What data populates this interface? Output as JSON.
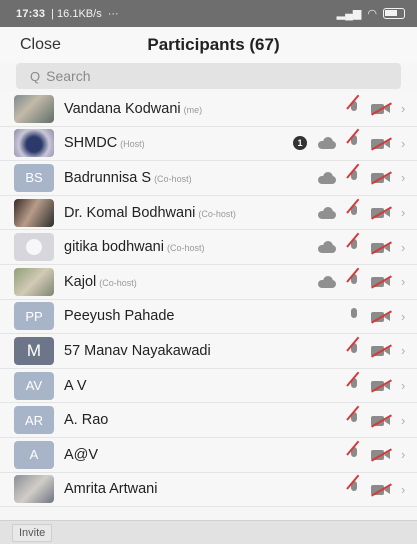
{
  "status_bar": {
    "time": "17:33",
    "speed": "| 16.1KB/s",
    "extra": "··· "
  },
  "header": {
    "close_label": "Close",
    "title": "Participants (67)"
  },
  "search": {
    "placeholder": "Search"
  },
  "participants": [
    {
      "name": "Vandana Kodwani",
      "role": "(me)",
      "avatar_type": "photo",
      "avatar_text": "",
      "unread": "",
      "recording": false,
      "mic_muted": true,
      "video_off": true
    },
    {
      "name": "SHMDC",
      "role": "(Host)",
      "avatar_type": "photo",
      "avatar_text": "",
      "unread": "1",
      "recording": true,
      "mic_muted": true,
      "video_off": true
    },
    {
      "name": "Badrunnisa S",
      "role": "(Co-host)",
      "avatar_type": "initials",
      "avatar_text": "BS",
      "unread": "",
      "recording": true,
      "mic_muted": true,
      "video_off": true
    },
    {
      "name": "Dr. Komal Bodhwani",
      "role": "(Co-host)",
      "avatar_type": "photo",
      "avatar_text": "",
      "unread": "",
      "recording": true,
      "mic_muted": true,
      "video_off": true
    },
    {
      "name": "gitika bodhwani",
      "role": "(Co-host)",
      "avatar_type": "default",
      "avatar_text": "",
      "unread": "",
      "recording": true,
      "mic_muted": true,
      "video_off": true
    },
    {
      "name": "Kajol",
      "role": "(Co-host)",
      "avatar_type": "photo",
      "avatar_text": "",
      "unread": "",
      "recording": true,
      "mic_muted": true,
      "video_off": true
    },
    {
      "name": "Peeyush Pahade",
      "role": "",
      "avatar_type": "initials",
      "avatar_text": "PP",
      "unread": "",
      "recording": false,
      "mic_muted": false,
      "video_off": true
    },
    {
      "name": "57 Manav Nayakawadi",
      "role": "",
      "avatar_type": "initials-dark",
      "avatar_text": "M",
      "unread": "",
      "recording": false,
      "mic_muted": true,
      "video_off": true
    },
    {
      "name": "A V",
      "role": "",
      "avatar_type": "initials",
      "avatar_text": "AV",
      "unread": "",
      "recording": false,
      "mic_muted": true,
      "video_off": true
    },
    {
      "name": "A. Rao",
      "role": "",
      "avatar_type": "initials",
      "avatar_text": "AR",
      "unread": "",
      "recording": false,
      "mic_muted": true,
      "video_off": true
    },
    {
      "name": "A@V",
      "role": "",
      "avatar_type": "initials",
      "avatar_text": "A",
      "unread": "",
      "recording": false,
      "mic_muted": true,
      "video_off": true
    },
    {
      "name": "Amrita Artwani",
      "role": "",
      "avatar_type": "photo",
      "avatar_text": "",
      "unread": "",
      "recording": false,
      "mic_muted": true,
      "video_off": true
    }
  ],
  "footer": {
    "invite_label": "Invite"
  },
  "colors": {
    "muted_red": "#d23b3b",
    "initials_bg": "#a8b5c9",
    "icon_gray": "#8b8b8b"
  }
}
